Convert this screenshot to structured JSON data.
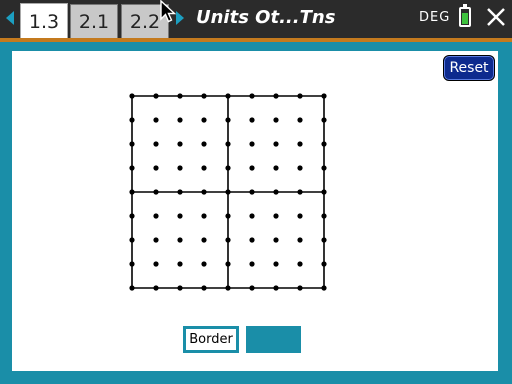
{
  "tabs": [
    {
      "label": "1.3",
      "active": true
    },
    {
      "label": "2.1",
      "active": false
    },
    {
      "label": "2.2",
      "active": false
    }
  ],
  "document_title": "Units Ot...Tns",
  "angle_mode": "DEG",
  "battery_level": 0.75,
  "icons": {
    "nav_left": "arrow-left-icon",
    "nav_right": "arrow-right-icon",
    "battery": "battery-icon",
    "close": "close-icon",
    "cursor": "mouse-cursor-icon"
  },
  "colors": {
    "accent": "#1a8ea8",
    "tab_separator": "#c47a1e",
    "reset_button": "#0d2a8e",
    "nav_arrow": "#1c9fc1"
  },
  "reset_button": {
    "label": "Reset"
  },
  "dot_grid": {
    "dots_per_side": 9,
    "subgrid_divisions": 2
  },
  "buttons": {
    "border_label": "Border",
    "blank_label": ""
  }
}
